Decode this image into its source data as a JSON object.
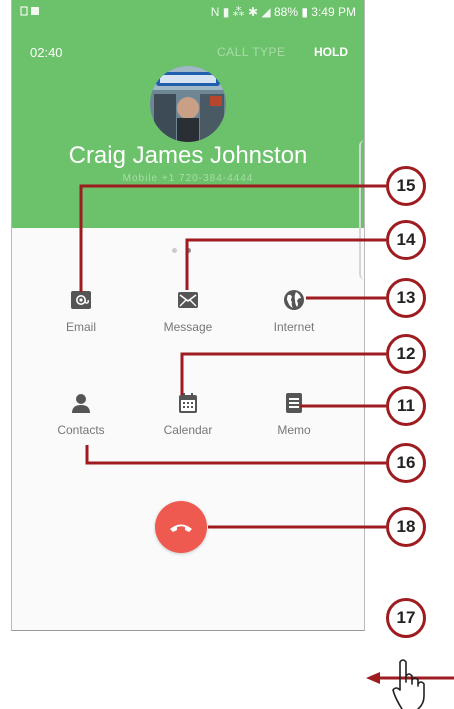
{
  "status_bar": {
    "left_icons": "",
    "signal_icons": "N ▮ ⁂ ✱ ◢",
    "battery": "88%",
    "time": "3:49 PM"
  },
  "call": {
    "timer": "02:40",
    "call_type_label": "CALL TYPE",
    "hold_label": "HOLD",
    "caller_name": "Craig James Johnston",
    "caller_subtitle": "Mobile +1 720-384-4444"
  },
  "actions": [
    {
      "label": "Email",
      "icon": "email-icon"
    },
    {
      "label": "Message",
      "icon": "message-icon"
    },
    {
      "label": "Internet",
      "icon": "internet-icon"
    },
    {
      "label": "Contacts",
      "icon": "contacts-icon"
    },
    {
      "label": "Calendar",
      "icon": "calendar-icon"
    },
    {
      "label": "Memo",
      "icon": "memo-icon"
    }
  ],
  "end_call": {
    "icon": "end-call-icon"
  },
  "callouts": {
    "c15": "15",
    "c14": "14",
    "c13": "13",
    "c12": "12",
    "c11": "11",
    "c16": "16",
    "c18": "18",
    "c17": "17"
  },
  "colors": {
    "header_green": "#6cc16b",
    "end_call_red": "#ee5a4f",
    "callout_red": "#9e1b20",
    "icon_gray": "#555555"
  }
}
